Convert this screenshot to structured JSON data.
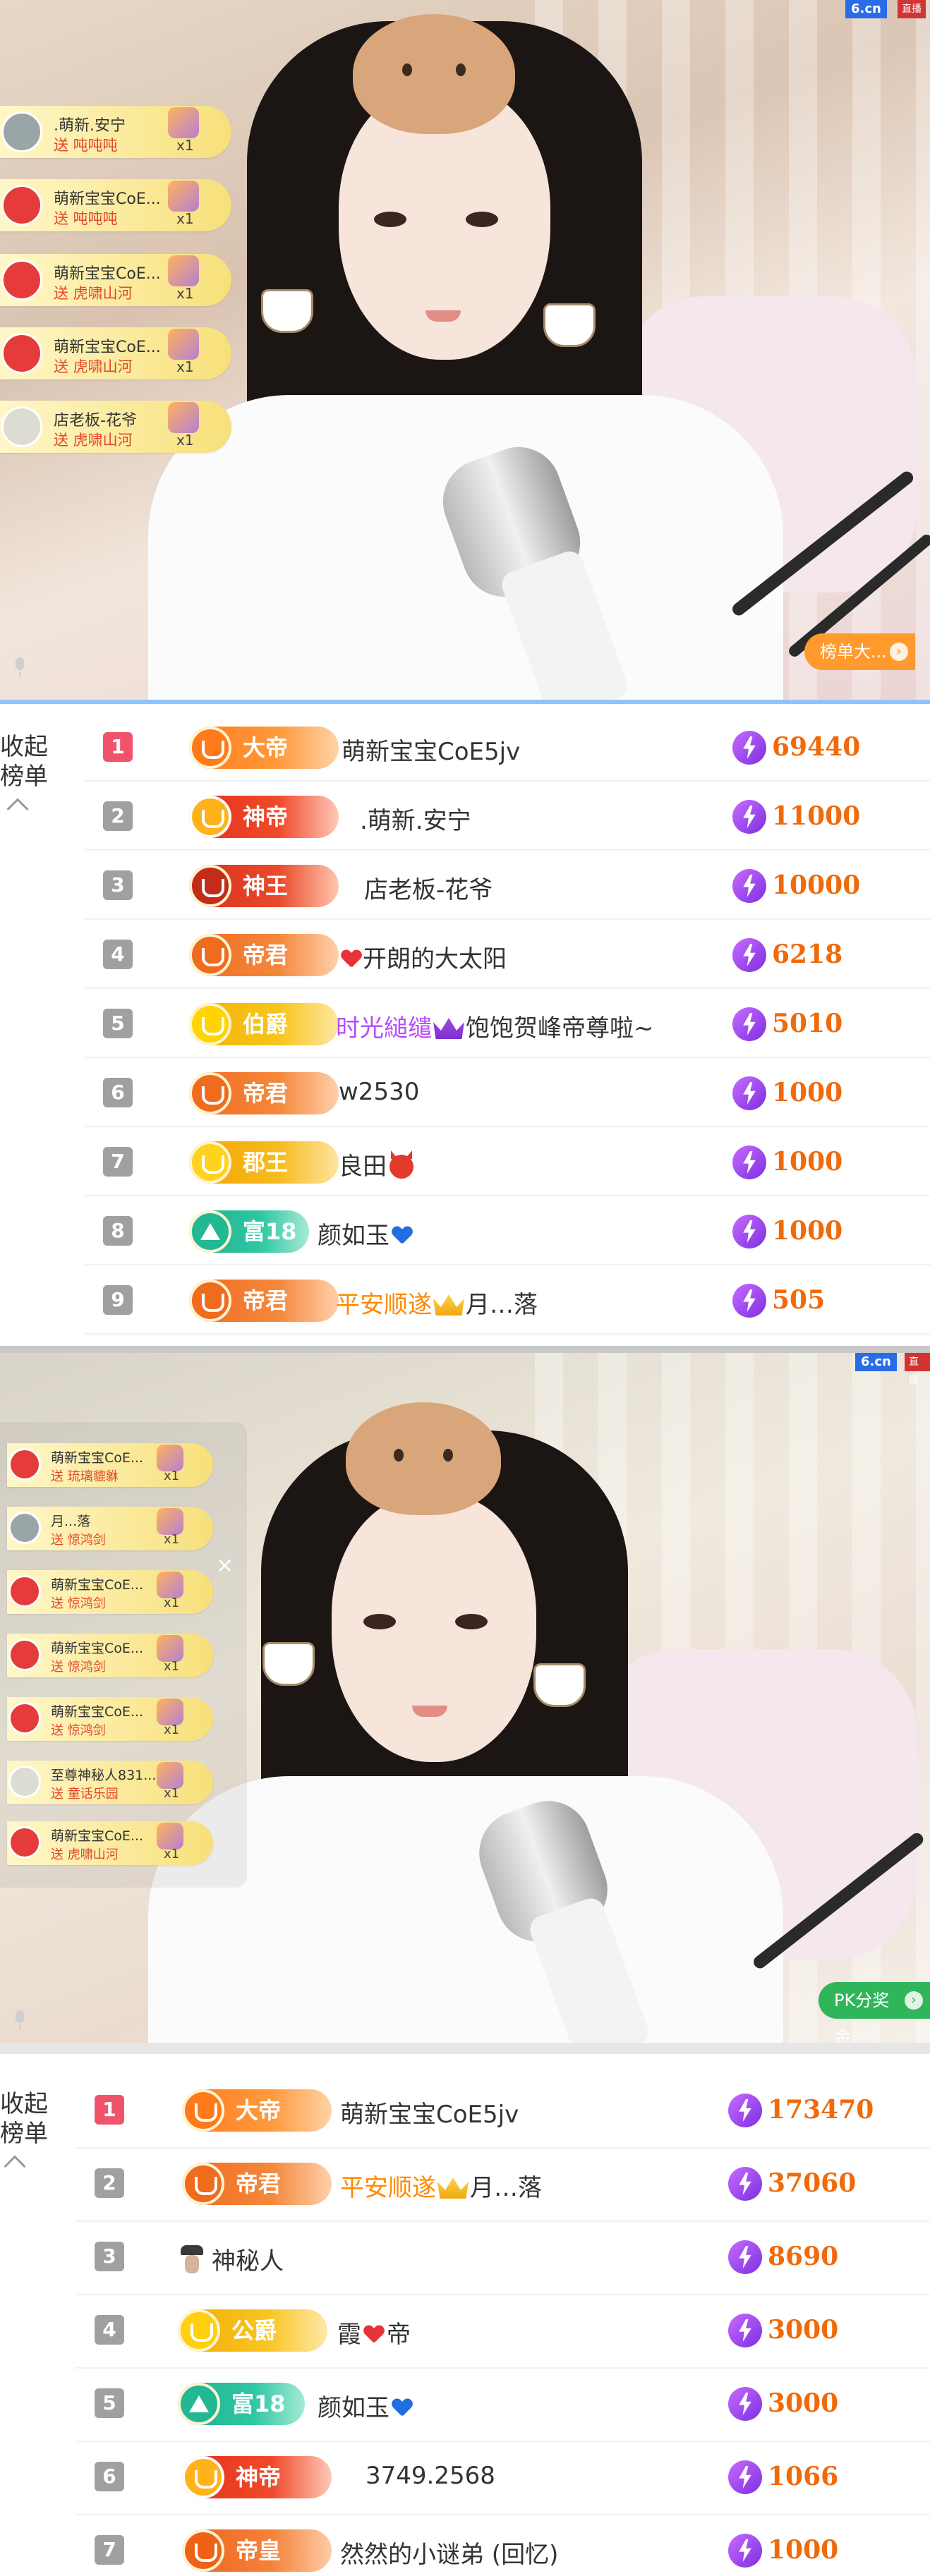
{
  "stream1": {
    "logo": "6.cn",
    "logo_tag": "直播",
    "corner_button": "榜单大...",
    "gifts": [
      {
        "name": ".萌新.安宁",
        "action": "送 吨吨吨",
        "count": "x1"
      },
      {
        "name": "萌新宝宝CoE...",
        "action": "送 吨吨吨",
        "count": "x1"
      },
      {
        "name": "萌新宝宝CoE...",
        "action": "送 虎啸山河",
        "count": "x1"
      },
      {
        "name": "萌新宝宝CoE...",
        "action": "送 虎啸山河",
        "count": "x1"
      },
      {
        "name": "店老板-花爷",
        "action": "送 虎啸山河",
        "count": "x1"
      }
    ]
  },
  "list1": {
    "collapse_label": "收起",
    "collapse_label2": "榜单",
    "rows": [
      {
        "rank": "1",
        "badge": "大帝",
        "name": "萌新宝宝CoE5jv",
        "score": "69440"
      },
      {
        "rank": "2",
        "badge": "神帝",
        "name": ".萌新.安宁",
        "score": "11000"
      },
      {
        "rank": "3",
        "badge": "神王",
        "name": "店老板-花爷",
        "score": "10000"
      },
      {
        "rank": "4",
        "badge": "帝君",
        "name": "开朗的大太阳",
        "score": "6218"
      },
      {
        "rank": "5",
        "badge": "伯爵",
        "name_a": "时光縋缱",
        "name_b": "饱饱贺峰帝尊啦~",
        "score": "5010"
      },
      {
        "rank": "6",
        "badge": "帝君",
        "name": "w2530",
        "score": "1000"
      },
      {
        "rank": "7",
        "badge": "郡王",
        "name": "良田",
        "score": "1000"
      },
      {
        "rank": "8",
        "badge": "富18",
        "name": "颜如玉",
        "score": "1000"
      },
      {
        "rank": "9",
        "badge": "帝君",
        "name_a": "平安顺遂",
        "name_b": "月…落",
        "score": "505"
      }
    ]
  },
  "stream2": {
    "logo": "6.cn",
    "logo_tag": "直播",
    "corner_button": "PK分奖金",
    "close": "×",
    "gifts": [
      {
        "name": "萌新宝宝CoE...",
        "action": "送 琉璃貔貅",
        "count": "x1"
      },
      {
        "name": "月...落",
        "action": "送 惊鸿剑",
        "count": "x1"
      },
      {
        "name": "萌新宝宝CoE...",
        "action": "送 惊鸿剑",
        "count": "x1"
      },
      {
        "name": "萌新宝宝CoE...",
        "action": "送 惊鸿剑",
        "count": "x1"
      },
      {
        "name": "萌新宝宝CoE...",
        "action": "送 惊鸿剑",
        "count": "x1"
      },
      {
        "name": "至尊神秘人831...",
        "action": "送 童话乐园",
        "count": "x1"
      },
      {
        "name": "萌新宝宝CoE...",
        "action": "送 虎啸山河",
        "count": "x1"
      }
    ]
  },
  "list2": {
    "collapse_label": "收起",
    "collapse_label2": "榜单",
    "rows": [
      {
        "rank": "1",
        "badge": "大帝",
        "name": "萌新宝宝CoE5jv",
        "score": "173470"
      },
      {
        "rank": "2",
        "badge": "帝君",
        "name_a": "平安顺遂",
        "name_b": "月…落",
        "score": "37060"
      },
      {
        "rank": "3",
        "name": "神秘人",
        "score": "8690"
      },
      {
        "rank": "4",
        "badge": "公爵",
        "name_a": "霞",
        "name_b": "帝",
        "score": "3000"
      },
      {
        "rank": "5",
        "badge": "富18",
        "name": "颜如玉",
        "score": "3000"
      },
      {
        "rank": "6",
        "badge": "神帝",
        "name": "3749.2568",
        "score": "1066"
      },
      {
        "rank": "7",
        "badge": "帝皇",
        "name": "然然的小谜弟 (回忆)",
        "score": "1000"
      }
    ]
  }
}
